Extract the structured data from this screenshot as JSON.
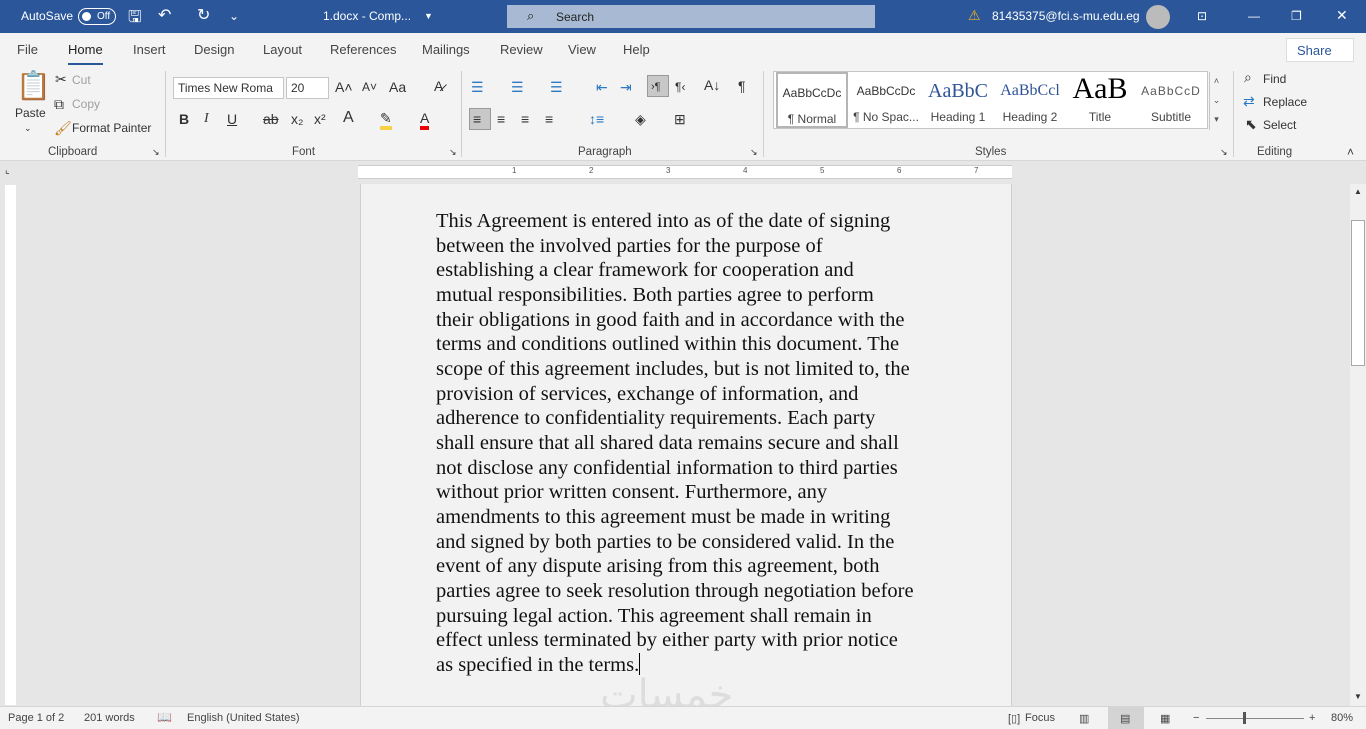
{
  "titlebar": {
    "autosave": "AutoSave",
    "autosave_state": "Off",
    "doc_title": "1.docx  -  Comp...",
    "search": "Search",
    "account": "81435375@fci.s-mu.edu.eg"
  },
  "tabs": [
    "File",
    "Home",
    "Insert",
    "Design",
    "Layout",
    "References",
    "Mailings",
    "Review",
    "View",
    "Help"
  ],
  "share": "Share",
  "clipboard": {
    "paste": "Paste",
    "cut": "Cut",
    "copy": "Copy",
    "format_painter": "Format Painter",
    "group": "Clipboard"
  },
  "font": {
    "name": "Times New Roma",
    "size": "20",
    "group": "Font",
    "case": "Aa"
  },
  "paragraph": {
    "group": "Paragraph"
  },
  "styles": {
    "group": "Styles",
    "items": [
      {
        "preview": "AaBbCcDc",
        "name": "¶ Normal"
      },
      {
        "preview": "AaBbCcDc",
        "name": "¶ No Spac..."
      },
      {
        "preview": "AaBbC",
        "name": "Heading 1"
      },
      {
        "preview": "AaBbCcl",
        "name": "Heading 2"
      },
      {
        "preview": "AaB",
        "name": "Title"
      },
      {
        "preview": "AaBbCcD",
        "name": "Subtitle"
      }
    ]
  },
  "editing": {
    "find": "Find",
    "replace": "Replace",
    "select": "Select",
    "group": "Editing"
  },
  "document": {
    "lines": [
      "This Agreement is entered into as of the date of signing",
      "between the involved parties for the purpose of",
      "establishing a clear framework for cooperation and",
      "mutual responsibilities. Both parties agree to perform",
      "their obligations in good faith and in accordance with the",
      "terms and conditions outlined within this document. The",
      "scope of this agreement includes, but is not limited to, the",
      "provision of services, exchange of information, and",
      "adherence to confidentiality requirements. Each party",
      "shall ensure that all shared data remains secure and shall",
      "not disclose any confidential information to third parties",
      "without prior written consent. Furthermore, any",
      "amendments to this agreement must be made in writing",
      "and signed by both parties to be considered valid. In the",
      "event of any dispute arising from this agreement, both",
      "parties agree to seek resolution through negotiation before",
      "pursuing legal action. This agreement shall remain in",
      "effect unless terminated by either party with prior notice",
      "as specified in the terms."
    ]
  },
  "watermark": "خمسات",
  "status": {
    "page": "Page 1 of 2",
    "words": "201 words",
    "language": "English (United States)",
    "focus": "Focus",
    "zoom": "80%",
    "zoom_percent": 80
  },
  "colors": {
    "brand": "#2b579a"
  }
}
